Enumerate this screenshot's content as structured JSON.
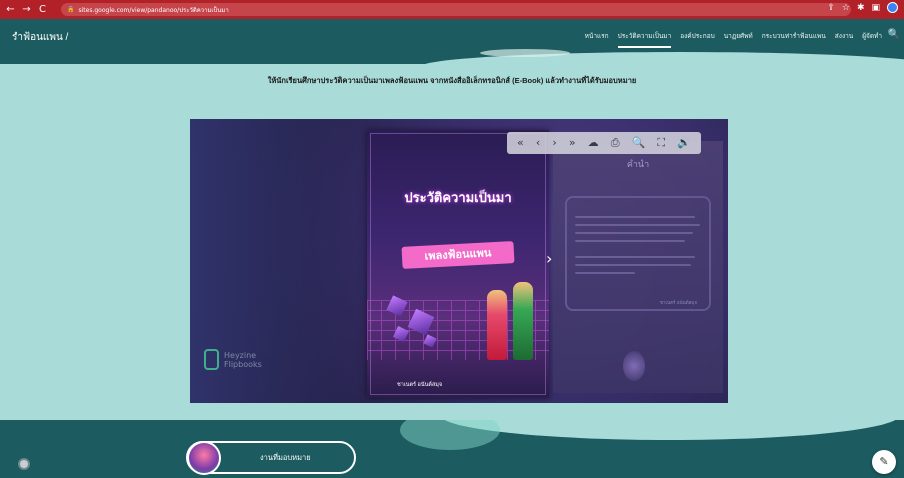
{
  "browser": {
    "url": "sites.google.com/view/pandanoo/ประวัติความเป็นมา",
    "nav_back": "←",
    "nav_forward": "→",
    "nav_reload": "C",
    "lock_icon": "🔒",
    "right_icons": [
      "⇪",
      "☆",
      "✱",
      "▣"
    ]
  },
  "site": {
    "title": "รำฟ้อนแพน /",
    "search_icon": "🔍",
    "menu": [
      {
        "label": "หน้าแรก",
        "active": false
      },
      {
        "label": "ประวัติความเป็นมา",
        "active": true
      },
      {
        "label": "องค์ประกอบ",
        "active": false
      },
      {
        "label": "นาฏยศัพท์",
        "active": false
      },
      {
        "label": "กระบวนท่ารำฟ้อนแพน",
        "active": false
      },
      {
        "label": "ส่งงาน",
        "active": false
      },
      {
        "label": "ผู้จัดทำ",
        "active": false
      }
    ]
  },
  "main": {
    "instruction": "ให้นักเรียนศึกษาประวัติความเป็นมาเพลงฟ้อนแพน จากหนังสืออิเล็กทรอนิกส์ (E-Book) แล้วทำงานที่ได้รับมอบหมาย"
  },
  "flipbook": {
    "toolbar": [
      "«",
      "‹",
      "›",
      "»",
      "☁",
      "⎙",
      "🔍",
      "⛶",
      "🔊"
    ],
    "cover_title1": "ประวัติความเป็นมา",
    "cover_title2": "เพลงฟ้อนแพน",
    "cover_author": "ชาเนตร์ อนันต์สมุจ",
    "page_title": "คำนำ",
    "page_signature": "ชาเนตร์ อนันต์สมุจ",
    "next_arrow": "›",
    "logo_text": "Heyzine\nFlipbooks"
  },
  "footer": {
    "assign_button": "งานที่มอบหมาย",
    "edit_icon": "✎"
  }
}
